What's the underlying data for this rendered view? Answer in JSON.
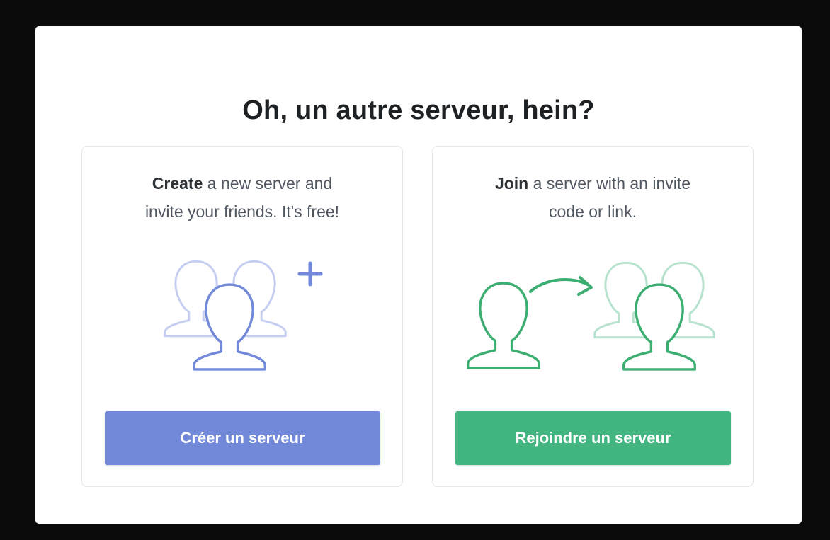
{
  "modal": {
    "title": "Oh, un autre serveur, hein?"
  },
  "create_card": {
    "bold": "Create",
    "line1_rest": " a new server and",
    "line2": "invite your friends. It's free!",
    "button_label": "Créer un serveur",
    "color": "#7289da",
    "icon": "users-plus-icon"
  },
  "join_card": {
    "bold": "Join",
    "line1_rest": " a server with an invite",
    "line2": "code or link.",
    "button_label": "Rejoindre un serveur",
    "color": "#43b581",
    "icon": "user-join-arrow-icon"
  },
  "colors": {
    "backdrop": "#0b0b0b",
    "modal_bg": "#ffffff",
    "create_accent": "#7289da",
    "join_accent": "#43b581",
    "join_icon": "#3dae72"
  }
}
